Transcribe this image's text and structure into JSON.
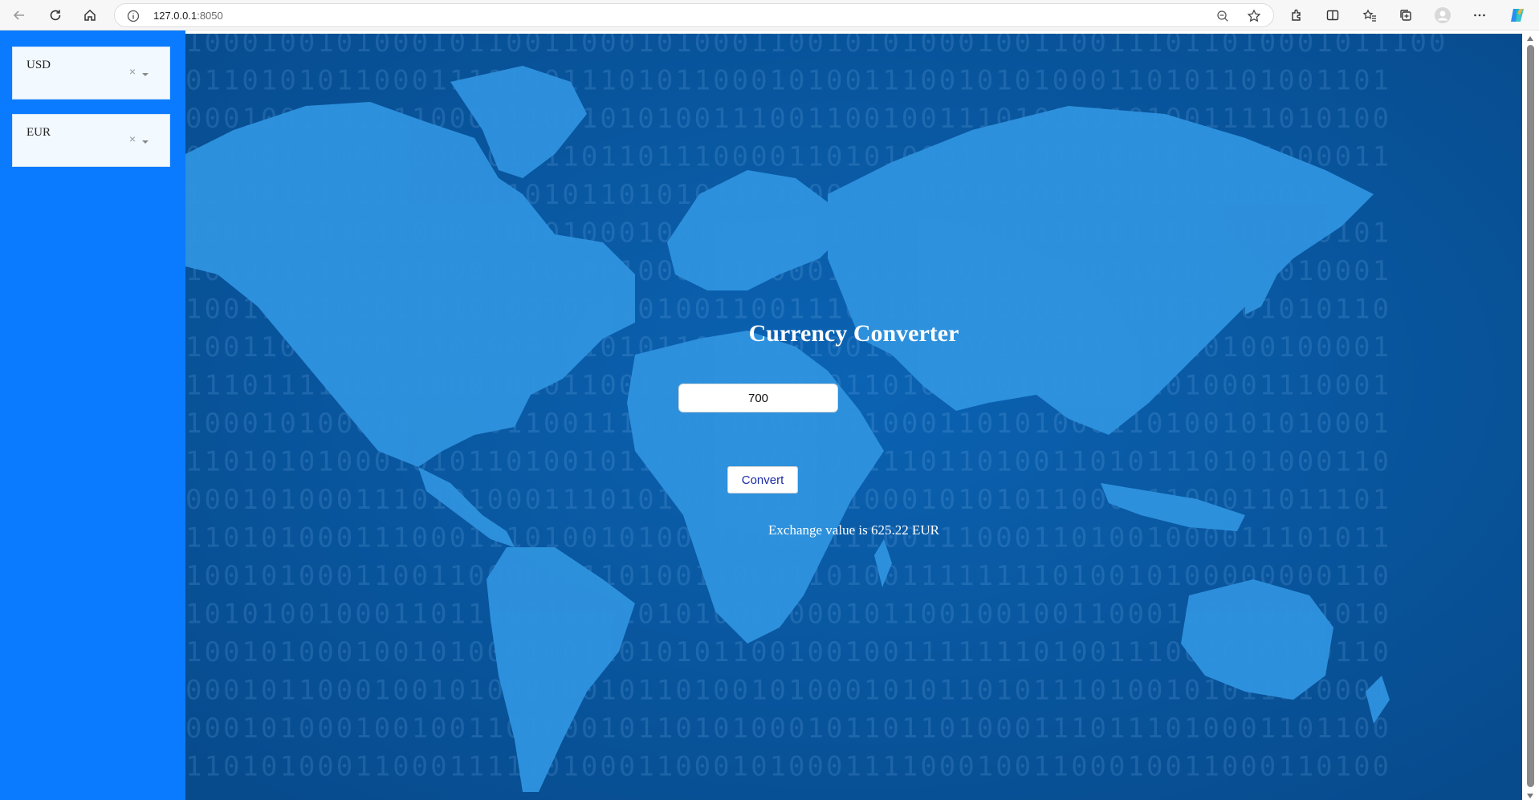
{
  "browser": {
    "url_host": "127.0.0.1",
    "url_port": ":8050",
    "icons": [
      "back-icon",
      "refresh-icon",
      "home-icon",
      "info-icon",
      "zoom-out-icon",
      "favorite-star-icon",
      "extensions-icon",
      "split-screen-icon",
      "favorites-icon",
      "collections-icon",
      "profile-icon",
      "more-icon",
      "copilot-icon"
    ]
  },
  "sidebar": {
    "from_currency": {
      "value": "USD",
      "clear": "×"
    },
    "to_currency": {
      "value": "EUR",
      "clear": "×"
    }
  },
  "main": {
    "title": "Currency Converter",
    "amount_value": "700",
    "convert_label": "Convert",
    "result_text": "Exchange value is 625.22 EUR"
  },
  "background": {
    "binary_rows": [
      "1000100101000101100110001010001100101010001001100111011010001011100",
      "0110101011000111010011101011000101001110010101000110101101001101",
      "0001001101111000111001010100111001100100111010100101001111010100",
      "0110011100110001011110110111000011010100011100101001011001000011",
      "1100011101110100110101101010110000011100000100110101101000001",
      "1000101000110001101010001001010110101010110101101011001001110101",
      "1010111110101000111010010001111000101011101010100110101000010001",
      "1001101101011010100101010100110011101101011000111101010001010110",
      "1001101100011101000101010110010101001011000100011011010100100001",
      "1110111110101000101011001100011101011010100011001001010001110001",
      "1000101000101101011001110100001001011000110101000110100101010001",
      "1101010100010101101001011001010001011110110100110101110101000110",
      "0001010001110101000111010100011110110001010101100011100011011101",
      "1101010001110001110100101000111000111001110001101001000011101011",
      "1001010001100110000101101001100011010011111111010010100000000110",
      "1010100100011011100100010101000100010110010010011000100110101010",
      "1001010001001010001001101010110010010011111110100111001010100110",
      "0001011000100101000100101101001010001010110101110100101011110001",
      "0001010001001001101000101101010001011011010001110111010001101100",
      "1101010001100011111010001100010100011110001001100010011000110100"
    ]
  }
}
